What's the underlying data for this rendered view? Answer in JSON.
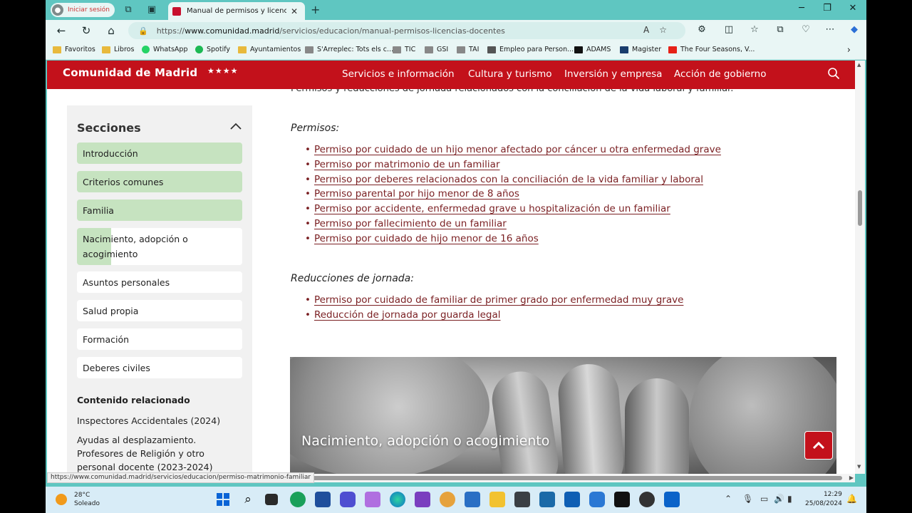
{
  "browser": {
    "profile_label": "Iniciar sesión",
    "tab_title": "Manual de permisos y licencias de",
    "url_prefix": "https://",
    "url_host": "www.comunidad.madrid",
    "url_path": "/servicios/educacion/manual-permisos-licencias-docentes",
    "status_url": "https://www.comunidad.madrid/servicios/educacion/permiso-matrimonio-familiar"
  },
  "bookmarks": [
    {
      "label": "Favoritos",
      "icon": "folder-icon"
    },
    {
      "label": "Libros",
      "icon": "folder-icon"
    },
    {
      "label": "WhatsApp",
      "icon": "whatsapp-icon"
    },
    {
      "label": "Spotify",
      "icon": "spotify-icon"
    },
    {
      "label": "Ayuntamientos",
      "icon": "folder-icon"
    },
    {
      "label": "S'Arrеplec: Tots els c...",
      "icon": "page-icon"
    },
    {
      "label": "TIC",
      "icon": "page-icon"
    },
    {
      "label": "GSI",
      "icon": "page-icon"
    },
    {
      "label": "TAI",
      "icon": "page-icon"
    },
    {
      "label": "Empleo para Person...",
      "icon": "page-icon"
    },
    {
      "label": "ADAMS",
      "icon": "adams-icon"
    },
    {
      "label": "Magister",
      "icon": "magister-icon"
    },
    {
      "label": "The Four Seasons, V...",
      "icon": "youtube-icon"
    }
  ],
  "site": {
    "logo": "Comunidad de Madrid",
    "logo_stars": "★★★★",
    "nav": [
      "Servicios e información",
      "Cultura y turismo",
      "Inversión y empresa",
      "Acción de gobierno"
    ]
  },
  "content": {
    "cut_text": "Permisos y reducciones de jornada relacionados con la conciliación de la vida laboral y familiar.",
    "permisos_label": "Permisos:",
    "permisos": [
      "Permiso por cuidado de un hijo menor afectado por cáncer u otra enfermedad grave",
      "Permiso por matrimonio de un familiar",
      "Permiso por deberes relacionados con la conciliación de la vida familiar y laboral",
      "Permiso parental por hijo menor de 8 años",
      "Permiso por accidente, enfermedad grave u hospitalización de un familiar",
      "Permiso por fallecimiento de un familiar",
      "Permiso por cuidado de hijo menor de 16 años"
    ],
    "reducciones_label": "Reducciones de jornada:",
    "reducciones": [
      "Permiso por cuidado de familiar de primer grado por enfermedad muy grave",
      "Reducción de jornada por guarda legal"
    ],
    "hero_title": "Nacimiento, adopción o acogimiento"
  },
  "sidebar": {
    "title": "Secciones",
    "items": [
      "Introducción",
      "Criterios comunes",
      "Familia",
      "Nacimiento, adopción o acogimiento",
      "Asuntos personales",
      "Salud propia",
      "Formación",
      "Deberes civiles"
    ],
    "related_title": "Contenido relacionado",
    "related": [
      "Inspectores Accidentales (2024)",
      "Ayudas al desplazamiento. Profesores de Religión y otro personal docente (2023-2024)"
    ]
  },
  "taskbar": {
    "temp": "28°C",
    "weather": "Soleado",
    "time": "12:29",
    "date": "25/08/2024"
  },
  "colors": {
    "brand_red": "#c3111b",
    "link": "#7a1f22",
    "section_green": "#c6e3c0",
    "browser_teal": "#5fc6c1"
  }
}
